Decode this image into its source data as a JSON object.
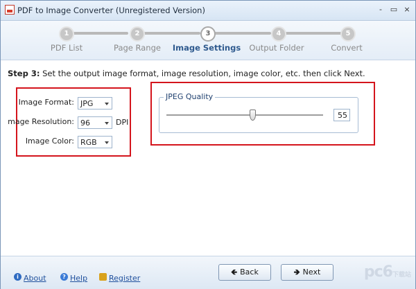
{
  "window": {
    "title": "PDF to Image Converter (Unregistered Version)",
    "controls": [
      "-",
      "▭",
      "×"
    ]
  },
  "steps": [
    {
      "number": "1",
      "label": "PDF List",
      "active": false
    },
    {
      "number": "2",
      "label": "Page Range",
      "active": false
    },
    {
      "number": "3",
      "label": "Image Settings",
      "active": true
    },
    {
      "number": "4",
      "label": "Output Folder",
      "active": false
    },
    {
      "number": "5",
      "label": "Convert",
      "active": false
    }
  ],
  "content": {
    "step_prefix": "Step 3:",
    "step_text": "Set the output image format, image resolution, image color, etc. then click Next.",
    "format_label": "Image Format:",
    "format_value": "JPG",
    "resolution_label": "mage Resolution:",
    "resolution_value": "96",
    "resolution_unit": "DPI",
    "color_label": "Image Color:",
    "color_value": "RGB",
    "jpeg_group_title": "JPEG Quality",
    "jpeg_quality": "55"
  },
  "footer": {
    "about_label": "About",
    "help_label": "Help",
    "register_label": "Register",
    "back_label": "Back",
    "next_label": "Next",
    "watermark": "pc6",
    "watermark_sub": "下载站"
  },
  "colors": {
    "highlight_red": "#d4141c",
    "active_step": "#2f5a8e",
    "link": "#1e4f9c"
  },
  "icons": {
    "about": "info-icon",
    "help": "help-icon",
    "register": "lock-icon",
    "back": "arrow-left-icon",
    "next": "arrow-right-icon"
  }
}
